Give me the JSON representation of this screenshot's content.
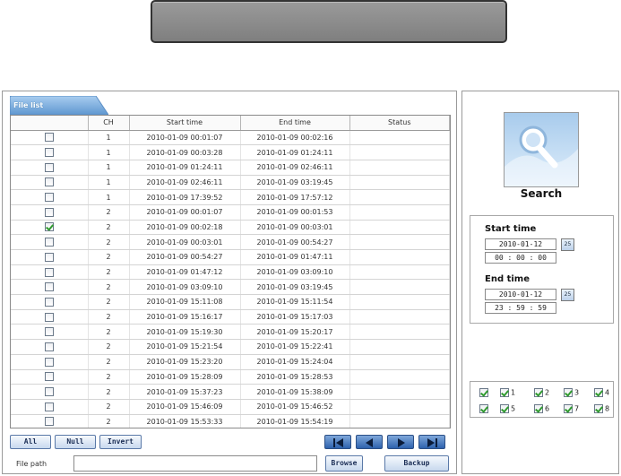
{
  "file_list": {
    "tab_label": "File list",
    "columns": [
      "",
      "CH",
      "Start time",
      "End time",
      "Status"
    ],
    "rows": [
      {
        "checked": false,
        "ch": "1",
        "start": "2010-01-09 00:01:07",
        "end": "2010-01-09 00:02:16",
        "status": ""
      },
      {
        "checked": false,
        "ch": "1",
        "start": "2010-01-09 00:03:28",
        "end": "2010-01-09 01:24:11",
        "status": ""
      },
      {
        "checked": false,
        "ch": "1",
        "start": "2010-01-09 01:24:11",
        "end": "2010-01-09 02:46:11",
        "status": ""
      },
      {
        "checked": false,
        "ch": "1",
        "start": "2010-01-09 02:46:11",
        "end": "2010-01-09 03:19:45",
        "status": ""
      },
      {
        "checked": false,
        "ch": "1",
        "start": "2010-01-09 17:39:52",
        "end": "2010-01-09 17:57:12",
        "status": ""
      },
      {
        "checked": false,
        "ch": "2",
        "start": "2010-01-09 00:01:07",
        "end": "2010-01-09 00:01:53",
        "status": ""
      },
      {
        "checked": true,
        "ch": "2",
        "start": "2010-01-09 00:02:18",
        "end": "2010-01-09 00:03:01",
        "status": ""
      },
      {
        "checked": false,
        "ch": "2",
        "start": "2010-01-09 00:03:01",
        "end": "2010-01-09 00:54:27",
        "status": ""
      },
      {
        "checked": false,
        "ch": "2",
        "start": "2010-01-09 00:54:27",
        "end": "2010-01-09 01:47:11",
        "status": ""
      },
      {
        "checked": false,
        "ch": "2",
        "start": "2010-01-09 01:47:12",
        "end": "2010-01-09 03:09:10",
        "status": ""
      },
      {
        "checked": false,
        "ch": "2",
        "start": "2010-01-09 03:09:10",
        "end": "2010-01-09 03:19:45",
        "status": ""
      },
      {
        "checked": false,
        "ch": "2",
        "start": "2010-01-09 15:11:08",
        "end": "2010-01-09 15:11:54",
        "status": ""
      },
      {
        "checked": false,
        "ch": "2",
        "start": "2010-01-09 15:16:17",
        "end": "2010-01-09 15:17:03",
        "status": ""
      },
      {
        "checked": false,
        "ch": "2",
        "start": "2010-01-09 15:19:30",
        "end": "2010-01-09 15:20:17",
        "status": ""
      },
      {
        "checked": false,
        "ch": "2",
        "start": "2010-01-09 15:21:54",
        "end": "2010-01-09 15:22:41",
        "status": ""
      },
      {
        "checked": false,
        "ch": "2",
        "start": "2010-01-09 15:23:20",
        "end": "2010-01-09 15:24:04",
        "status": ""
      },
      {
        "checked": false,
        "ch": "2",
        "start": "2010-01-09 15:28:09",
        "end": "2010-01-09 15:28:53",
        "status": ""
      },
      {
        "checked": false,
        "ch": "2",
        "start": "2010-01-09 15:37:23",
        "end": "2010-01-09 15:38:09",
        "status": ""
      },
      {
        "checked": false,
        "ch": "2",
        "start": "2010-01-09 15:46:09",
        "end": "2010-01-09 15:46:52",
        "status": ""
      },
      {
        "checked": false,
        "ch": "2",
        "start": "2010-01-09 15:53:33",
        "end": "2010-01-09 15:54:19",
        "status": ""
      }
    ]
  },
  "selection_buttons": {
    "all": "All",
    "null": "Null",
    "invert": "Invert"
  },
  "nav_icons": [
    "first-page-icon",
    "previous-page-icon",
    "next-page-icon",
    "last-page-icon"
  ],
  "file_path": {
    "label": "File path",
    "value": ""
  },
  "buttons": {
    "browse": "Browse",
    "backup": "Backup"
  },
  "search": {
    "label": "Search",
    "icon": "magnifier-icon"
  },
  "time_filter": {
    "start_label": "Start time",
    "start_date": "2010-01-12",
    "start_clock": "00 : 00 : 00",
    "end_label": "End time",
    "end_date": "2010-01-12",
    "end_clock": "23 : 59 : 59",
    "calendar_icon_text": "25"
  },
  "channels": [
    {
      "label": "",
      "checked": true
    },
    {
      "label": "1",
      "checked": true
    },
    {
      "label": "2",
      "checked": true
    },
    {
      "label": "3",
      "checked": true
    },
    {
      "label": "4",
      "checked": true
    },
    {
      "label": "",
      "checked": true
    },
    {
      "label": "5",
      "checked": true
    },
    {
      "label": "6",
      "checked": true
    },
    {
      "label": "7",
      "checked": true
    },
    {
      "label": "8",
      "checked": true
    }
  ],
  "colors": {
    "title_bar": "#8c8c8c",
    "nav_button": "#3a6db5",
    "tab": "#6fa6dc",
    "check": "#2f9a2f"
  }
}
